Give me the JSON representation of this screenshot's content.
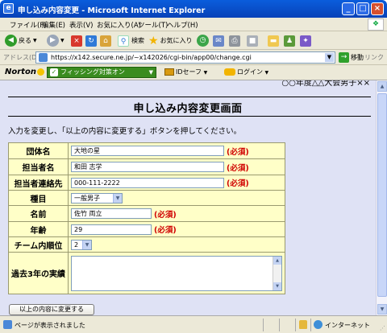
{
  "window": {
    "title": "申し込み内容変更 - Microsoft Internet Explorer",
    "minimize_icon": "minimize-icon",
    "maximize_icon": "maximize-icon",
    "close_icon": "close-icon"
  },
  "menu": {
    "items": [
      "ファイル(F)",
      "編集(E)",
      "表示(V)",
      "お気に入り(A)",
      "ツール(T)",
      "ヘルプ(H)"
    ]
  },
  "toolbar": {
    "back_label": "戻る",
    "search_label": "検索",
    "favorites_label": "お気に入り"
  },
  "address": {
    "label": "アドレス(D)",
    "url": "https://x142.secure.ne.jp/~x142026/cgi-bin/app00/change.cgi",
    "go_label": "移動",
    "links_label": "リンク"
  },
  "norton": {
    "logo": "Norton",
    "phishing_label": "フィッシング対策オン",
    "idsafe_label": "IDセーフ",
    "login_label": "ログイン"
  },
  "page": {
    "event_name": "○○年度△△大会男子××",
    "title": "申し込み内容変更画面",
    "instruction": "入力を変更し、「以上の内容に変更する」ボタンを押してください。",
    "required_mark": "(必須)",
    "fields": {
      "team_name": {
        "label": "団体名",
        "value": "大地の星"
      },
      "contact_name": {
        "label": "担当者名",
        "value": "和田 志学"
      },
      "contact_phone": {
        "label": "担当者連絡先",
        "value": "000-111-2222"
      },
      "category": {
        "label": "種目",
        "value": "一般男子"
      },
      "name": {
        "label": "名前",
        "value": "佐竹 両立"
      },
      "age": {
        "label": "年齢",
        "value": "29"
      },
      "team_rank": {
        "label": "チーム内順位",
        "value": "2"
      },
      "history": {
        "label": "過去3年の実績",
        "value": ""
      }
    },
    "submit_label": "以上の内容に変更する"
  },
  "status": {
    "text": "ページが表示されました",
    "zone": "インターネット"
  }
}
